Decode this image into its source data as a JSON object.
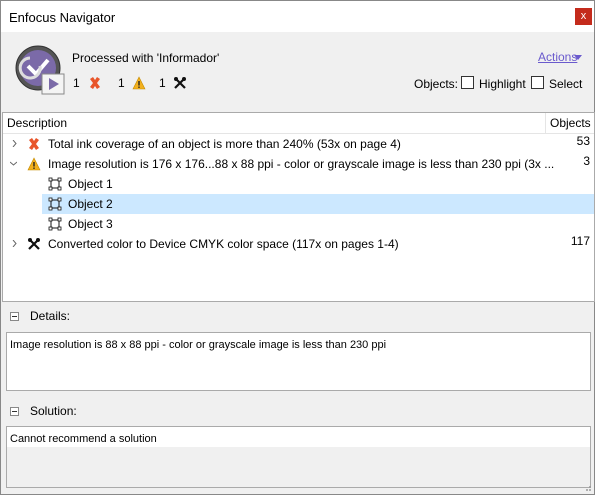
{
  "window": {
    "title": "Enfocus Navigator",
    "close_label": "x"
  },
  "header": {
    "processed_text": "Processed with 'Informador'",
    "actions_label": "Actions",
    "counts": {
      "errors": "1",
      "warnings": "1",
      "fixes": "1"
    },
    "objects_label": "Objects:",
    "highlight_label": "Highlight",
    "select_label": "Select"
  },
  "tree": {
    "columns": {
      "description": "Description",
      "objects": "Objects"
    },
    "rows": [
      {
        "text": "Total ink coverage of an object is more than 240% (53x on page 4)",
        "count": "53",
        "icon": "error-icon"
      },
      {
        "text": "Image resolution is 176 x 176...88 x 88 ppi - color or grayscale image is less than 230 ppi (3x ...",
        "count": "3",
        "icon": "warning-icon"
      },
      {
        "text": "Object 1",
        "icon": "object-icon"
      },
      {
        "text": "Object 2",
        "icon": "object-icon"
      },
      {
        "text": "Object 3",
        "icon": "object-icon"
      },
      {
        "text": "Converted color to Device CMYK color space (117x on pages 1-4)",
        "count": "117",
        "icon": "fix-icon"
      }
    ]
  },
  "details": {
    "label": "Details:",
    "text": "Image resolution is 88 x 88 ppi - color or grayscale image is less than 230 ppi"
  },
  "solution": {
    "label": "Solution:",
    "text": "Cannot recommend a solution"
  },
  "colors": {
    "accent": "#6a5acd",
    "selection": "#cce8ff",
    "close": "#c42b1c",
    "error": "#e8552a",
    "warning": "#f2b01e"
  }
}
